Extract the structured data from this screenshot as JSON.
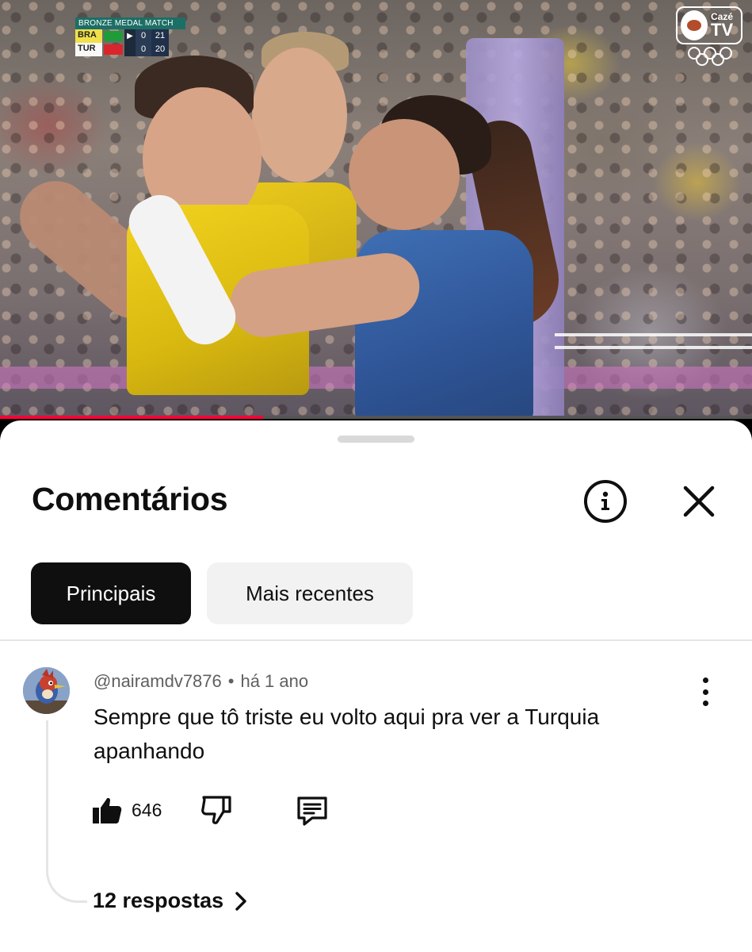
{
  "video": {
    "scorebug": {
      "title": "BRONZE MEDAL MATCH",
      "teams": [
        {
          "code": "BRA",
          "sets": "0",
          "points": "21",
          "serving": true
        },
        {
          "code": "TUR",
          "sets": "0",
          "points": "20",
          "serving": false
        }
      ]
    },
    "channel_logo": {
      "name": "Cazé",
      "tv": "TV"
    },
    "progress_fraction": 0.35
  },
  "sheet": {
    "title": "Comentários",
    "info_icon": "info-icon",
    "close_icon": "close-icon",
    "filters": [
      {
        "label": "Principais",
        "active": true
      },
      {
        "label": "Mais recentes",
        "active": false
      }
    ]
  },
  "comment": {
    "author": "@nairamdv7876",
    "separator": "•",
    "time": "há 1 ano",
    "text": "Sempre que tô triste eu volto aqui pra ver a Turquia apanhando",
    "likes": "646",
    "replies_label": "12 respostas",
    "icons": [
      "thumbs-up-icon",
      "thumbs-down-icon",
      "reply-icon",
      "more-vert-icon",
      "chevron-right-icon"
    ]
  },
  "colors": {
    "progress": "#ff0033",
    "chip_active_bg": "#0f0f0f",
    "chip_inactive_bg": "#f2f2f2",
    "secondary_text": "#606060"
  }
}
